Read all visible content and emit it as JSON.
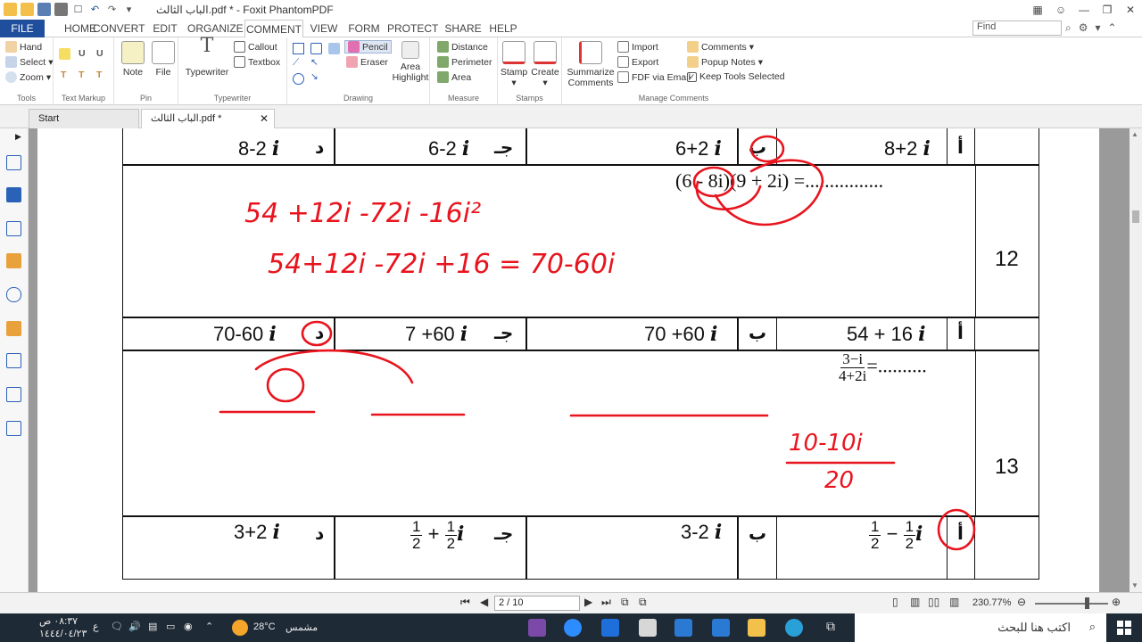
{
  "window": {
    "title": "الباب الثالث.pdf * - Foxit PhantomPDF",
    "quick_access": [
      "folder-open-icon",
      "folder-icon",
      "save-icon",
      "print-icon",
      "select-icon",
      "undo-icon",
      "redo-icon",
      "dropdown-icon"
    ]
  },
  "menu": {
    "tabs": [
      "FILE",
      "HOME",
      "CONVERT",
      "EDIT",
      "ORGANIZE",
      "COMMENT",
      "VIEW",
      "FORM",
      "PROTECT",
      "SHARE",
      "HELP"
    ],
    "active": "COMMENT",
    "find_placeholder": "Find"
  },
  "ribbon": {
    "tools": {
      "hand": "Hand",
      "select": "Select",
      "zoom": "Zoom",
      "label": "Tools"
    },
    "text_markup": {
      "label": "Text Markup"
    },
    "pin": {
      "note": "Note",
      "file": "File",
      "label": "Pin"
    },
    "typewriter": {
      "typewriter": "Typewriter",
      "callout": "Callout",
      "textbox": "Textbox",
      "label": "Typewriter"
    },
    "drawing": {
      "pencil": "Pencil",
      "eraser": "Eraser",
      "area_highlight": "Area Highlight",
      "label": "Drawing"
    },
    "measure": {
      "distance": "Distance",
      "perimeter": "Perimeter",
      "area": "Area",
      "label": "Measure"
    },
    "stamps": {
      "stamp": "Stamp",
      "create": "Create",
      "label": "Stamps"
    },
    "manage": {
      "summarize": "Summarize Comments",
      "import": "Import",
      "export": "Export",
      "fdf": "FDF via Email",
      "comments": "Comments",
      "popup": "Popup Notes",
      "keep": "Keep Tools Selected",
      "label": "Manage Comments"
    }
  },
  "doc_tabs": [
    {
      "label": "Start"
    },
    {
      "label": "الباب الثالث.pdf *"
    }
  ],
  "document": {
    "row_top": {
      "a": "8+2",
      "b": "6+2",
      "c": "6-2",
      "d": "8-2"
    },
    "q12": {
      "number": "12",
      "question": "(6 - 8i)(9 + 2i) =................",
      "work1": "54 +12i -72i -16i²",
      "work2": "54+12i -72i +16 = 70-60i"
    },
    "row12": {
      "a": "54 + 16",
      "b": "70 +60",
      "c": "7 +60",
      "d": "70-60"
    },
    "q13": {
      "number": "13",
      "question_num": "3−i",
      "question_den": "4+2i",
      "question_tail": "=..........",
      "work_result_num": "10-10i",
      "work_result_den": "20"
    },
    "row13": {
      "a_num": "1",
      "a_den": "2",
      "a_mid": "−",
      "b": "3-2",
      "c_num": "1",
      "c_den": "2",
      "c_plus": "+",
      "d": "3+2"
    },
    "letters": {
      "a": "أ",
      "b": "ب",
      "c": "جـ",
      "d": "د"
    },
    "imag": "i",
    "ink_color": "#e8141e"
  },
  "status": {
    "page": "2 / 10",
    "zoom": "230.77%"
  },
  "taskbar": {
    "time": "٠٨:٣٧ ص",
    "date": "١٤٤٤/٠٤/٢٣",
    "weather": "28°C",
    "weather_label": "مشمس",
    "search_placeholder": "اكتب هنا للبحث",
    "lang": "ع"
  }
}
